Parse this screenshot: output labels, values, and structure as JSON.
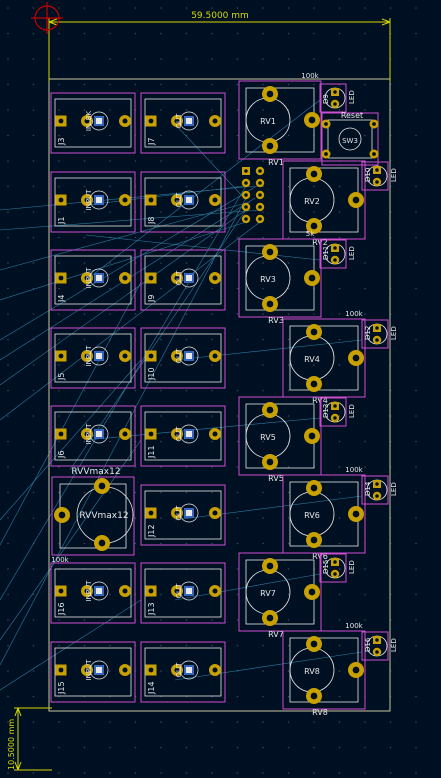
{
  "colors": {
    "background": "#001023",
    "grid_dot": "#3a4660",
    "dimension": "#d8d800",
    "edge_cuts": "#c8c8a0",
    "courtyard": "#d04cd0",
    "pad": "#c8a000",
    "pad_hole": "#001023",
    "ratsnest": "#3aa0c8",
    "silkscreen": "#e6e6e6",
    "origin": "#c80000"
  },
  "dimensions": {
    "width_label": "59.5000 mm",
    "height_label": "10.5000 mm"
  },
  "jacks_left": [
    {
      "ref": "J3",
      "value": "IN_BK"
    },
    {
      "ref": "J1",
      "value": "INPUT"
    },
    {
      "ref": "J4",
      "value": "INPUT"
    },
    {
      "ref": "J5",
      "value": "INPUT"
    },
    {
      "ref": "J6",
      "value": "INPUT"
    },
    {
      "ref": "J16",
      "value": "INPUT"
    },
    {
      "ref": "J15",
      "value": "INPUT"
    }
  ],
  "jacks_mid": [
    {
      "ref": "J7",
      "value": "OUT"
    },
    {
      "ref": "J8",
      "value": "OUT"
    },
    {
      "ref": "J9",
      "value": "OUT"
    },
    {
      "ref": "J10",
      "value": "OUT"
    },
    {
      "ref": "J11",
      "value": "OUT"
    },
    {
      "ref": "J12",
      "value": "OUT"
    },
    {
      "ref": "J13",
      "value": "OUT"
    },
    {
      "ref": "J14",
      "value": "OUT"
    }
  ],
  "big_pot": {
    "ref": "RVVmax12",
    "value": "RVVmax12",
    "value_below": "100k"
  },
  "pots": [
    {
      "ref": "RV1",
      "value": "RV1",
      "value_label": "100k"
    },
    {
      "ref": "RV2",
      "value": "RV2",
      "value_label": ""
    },
    {
      "ref": "RV3",
      "value": "RV3",
      "value_label": "5k"
    },
    {
      "ref": "RV4",
      "value": "RV4",
      "value_label": "100k"
    },
    {
      "ref": "RV5",
      "value": "RV5",
      "value_label": ""
    },
    {
      "ref": "RV6",
      "value": "RV6",
      "value_label": "100k"
    },
    {
      "ref": "RV7",
      "value": "RV7",
      "value_label": ""
    },
    {
      "ref": "RV8",
      "value": "RV8",
      "value_label": "100k"
    }
  ],
  "leds": [
    {
      "ref": "D9",
      "value": "LED"
    },
    {
      "ref": "D10",
      "value": "LED"
    },
    {
      "ref": "D11",
      "value": "LED"
    },
    {
      "ref": "D12",
      "value": "LED"
    },
    {
      "ref": "D13",
      "value": "LED"
    },
    {
      "ref": "D14",
      "value": "LED"
    },
    {
      "ref": "D15",
      "value": "LED"
    },
    {
      "ref": "D16",
      "value": "LED"
    }
  ],
  "switch": {
    "ref": "SW3",
    "value": "Reset"
  }
}
